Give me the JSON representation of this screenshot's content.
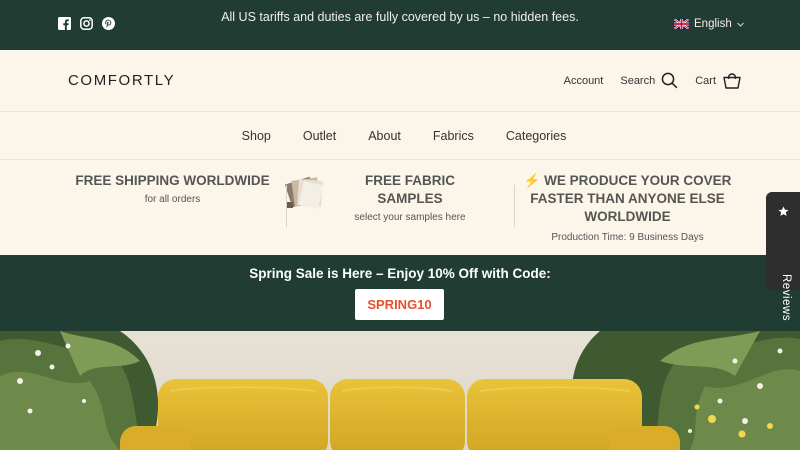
{
  "topbar": {
    "social": [
      "facebook-icon",
      "instagram-icon",
      "pinterest-icon"
    ],
    "announcement": "All US tariffs and duties are fully covered by us – no hidden fees.",
    "language": "English"
  },
  "header": {
    "logo": "COMFORTLY",
    "account": "Account",
    "search": "Search",
    "cart": "Cart"
  },
  "nav": {
    "items": [
      "Shop",
      "Outlet",
      "About",
      "Fabrics",
      "Categories"
    ]
  },
  "features": [
    {
      "title": "FREE SHIPPING WORLDWIDE",
      "sub": "for all orders"
    },
    {
      "title": "FREE FABRIC SAMPLES",
      "sub": "select your samples here"
    },
    {
      "title": "⚡ WE PRODUCE YOUR COVER FASTER THAN ANYONE ELSE WORLDWIDE",
      "sub": "Production Time: 9 Business Days"
    }
  ],
  "sale": {
    "title": "Spring Sale is Here – Enjoy 10% Off with Code:",
    "code": "SPRING10"
  },
  "reviews_tab": "Reviews",
  "colors": {
    "dark_green": "#213d33",
    "cream": "#fcf6ea",
    "code_red": "#e8502b",
    "sofa_yellow": "#e2b72c"
  }
}
